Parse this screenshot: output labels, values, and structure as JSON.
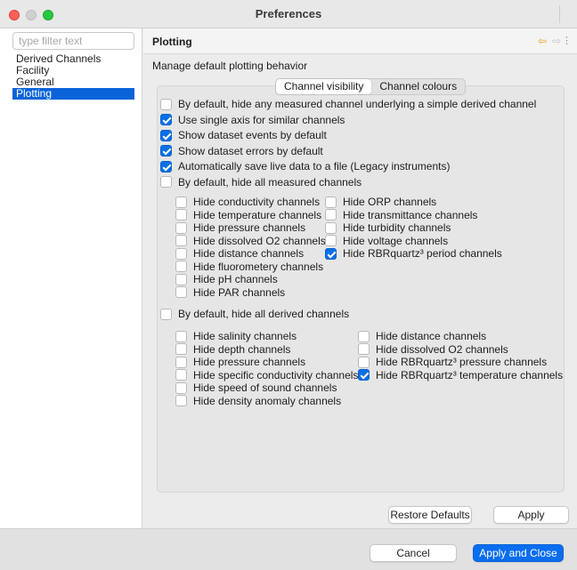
{
  "window": {
    "title": "Preferences"
  },
  "sidebar": {
    "filter_placeholder": "type filter text",
    "items": [
      {
        "label": "Derived Channels"
      },
      {
        "label": "Facility"
      },
      {
        "label": "General"
      },
      {
        "label": "Plotting"
      }
    ],
    "selected": "Plotting"
  },
  "page": {
    "title": "Plotting",
    "description": "Manage default plotting behavior",
    "nav": {
      "back": "⇦",
      "forward": "⇨",
      "menu": "⋮"
    }
  },
  "tabs": [
    {
      "label": "Channel visibility",
      "active": true
    },
    {
      "label": "Channel colours",
      "active": false
    }
  ],
  "options": [
    {
      "label": "By default, hide any measured channel underlying a simple derived channel",
      "checked": false
    },
    {
      "label": "Use single axis for similar channels",
      "checked": true
    },
    {
      "label": "Show dataset events by default",
      "checked": true
    },
    {
      "label": "Show dataset errors by default",
      "checked": true
    },
    {
      "label": "Automatically save live data to a file (Legacy instruments)",
      "checked": true
    },
    {
      "label": "By default, hide all measured channels",
      "checked": false
    }
  ],
  "measured_left": [
    {
      "label": "Hide conductivity channels",
      "checked": false
    },
    {
      "label": "Hide temperature channels",
      "checked": false
    },
    {
      "label": "Hide pressure channels",
      "checked": false
    },
    {
      "label": "Hide dissolved O2 channels",
      "checked": false
    },
    {
      "label": "Hide distance channels",
      "checked": false
    },
    {
      "label": "Hide fluorometery channels",
      "checked": false
    },
    {
      "label": "Hide pH channels",
      "checked": false
    },
    {
      "label": "Hide PAR channels",
      "checked": false
    }
  ],
  "measured_right": [
    {
      "label": "Hide ORP channels",
      "checked": false
    },
    {
      "label": "Hide transmittance channels",
      "checked": false
    },
    {
      "label": "Hide turbidity channels",
      "checked": false
    },
    {
      "label": "Hide voltage channels",
      "checked": false
    },
    {
      "label": "Hide RBRquartz³ period channels",
      "checked": true
    }
  ],
  "derived_option": {
    "label": "By default, hide all derived channels",
    "checked": false
  },
  "derived_left": [
    {
      "label": "Hide salinity channels",
      "checked": false
    },
    {
      "label": "Hide depth channels",
      "checked": false
    },
    {
      "label": "Hide pressure channels",
      "checked": false
    },
    {
      "label": "Hide specific conductivity channels",
      "checked": false
    },
    {
      "label": "Hide speed of sound channels",
      "checked": false
    },
    {
      "label": "Hide density anomaly channels",
      "checked": false
    }
  ],
  "derived_right": [
    {
      "label": "Hide distance channels",
      "checked": false
    },
    {
      "label": "Hide dissolved O2 channels",
      "checked": false
    },
    {
      "label": "Hide RBRquartz³ pressure channels",
      "checked": false
    },
    {
      "label": "Hide RBRquartz³ temperature channels",
      "checked": true
    }
  ],
  "buttons": {
    "restore_defaults": "Restore Defaults",
    "apply": "Apply",
    "cancel": "Cancel",
    "apply_and_close": "Apply and Close"
  },
  "colors": {
    "accent": "#0a6df0",
    "selection": "#0a63d8",
    "back_arrow": "#e7a21b"
  }
}
